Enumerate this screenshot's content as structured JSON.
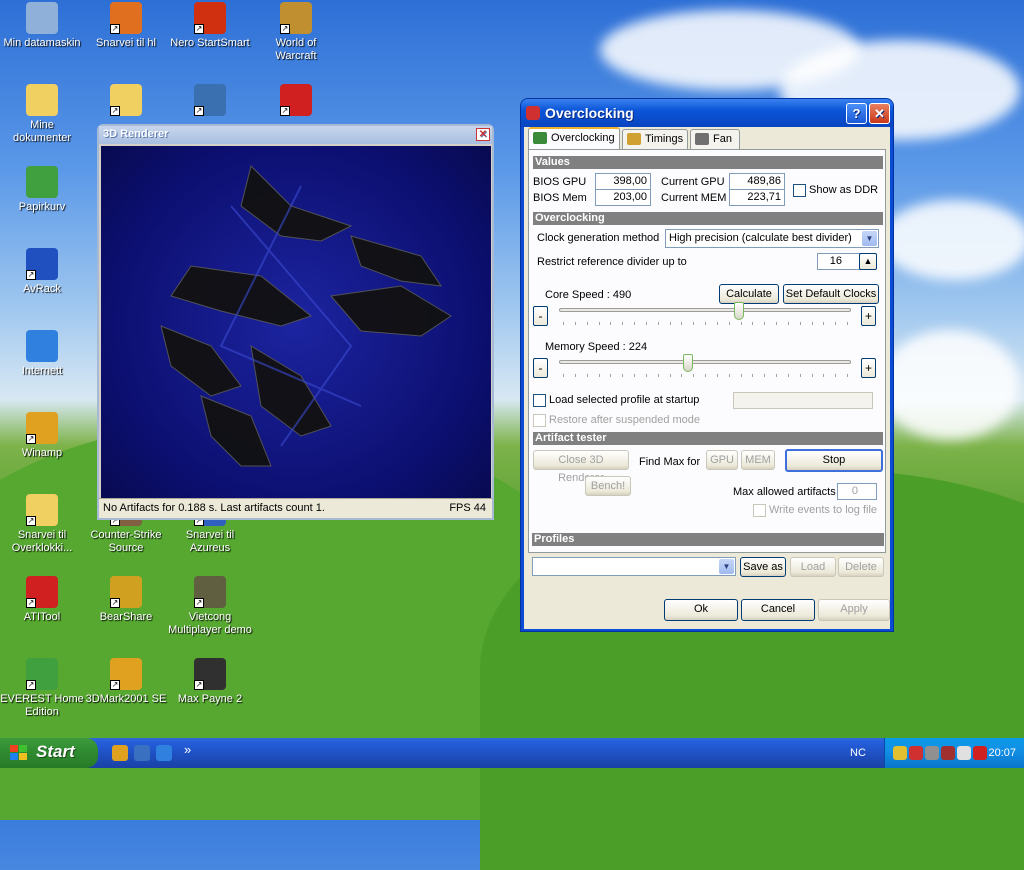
{
  "desktop": {
    "icons": [
      {
        "label": "Min datamaskin",
        "color": "#8fb0d8"
      },
      {
        "label": "Snarvei til hl",
        "color": "#e07020"
      },
      {
        "label": "Nero StartSmart",
        "color": "#d03010"
      },
      {
        "label": "World of Warcraft",
        "color": "#c09030"
      },
      {
        "label": "Mine dokumenter",
        "color": "#f0d060"
      },
      {
        "label": "",
        "color": "#f0d060"
      },
      {
        "label": "",
        "color": "#3a6fb0"
      },
      {
        "label": "",
        "color": "#d02020"
      },
      {
        "label": "Papirkurv",
        "color": "#40a040"
      },
      {
        "label": "AvRack",
        "color": "#2050c0"
      },
      {
        "label": "Internett",
        "color": "#3080e0"
      },
      {
        "label": "Winamp",
        "color": "#e0a020"
      },
      {
        "label": "Snarvei til Overklokki...",
        "color": "#f0d060"
      },
      {
        "label": "Counter-Strike Source",
        "color": "#806040"
      },
      {
        "label": "Snarvei til Azureus",
        "color": "#3060c0"
      },
      {
        "label": "ATITool",
        "color": "#d02020"
      },
      {
        "label": "BearShare",
        "color": "#d0a020"
      },
      {
        "label": "Vietcong Multiplayer demo",
        "color": "#606040"
      },
      {
        "label": "EVEREST Home Edition",
        "color": "#40a040"
      },
      {
        "label": "3DMark2001 SE",
        "color": "#e0a020"
      },
      {
        "label": "Max Payne 2",
        "color": "#303030"
      }
    ]
  },
  "renderer": {
    "title": "3D Renderer",
    "status_left": "No Artifacts for 0.188 s. Last artifacts count 1.",
    "status_right": "FPS 44"
  },
  "dialog": {
    "title": "Overclocking",
    "help_label": "?",
    "close_label": "✕",
    "tabs": [
      {
        "label": "Overclocking"
      },
      {
        "label": "Timings"
      },
      {
        "label": "Fan"
      }
    ],
    "values": {
      "section": "Values",
      "bios_gpu_label": "BIOS GPU",
      "bios_gpu": "398,00",
      "bios_mem_label": "BIOS Mem",
      "bios_mem": "203,00",
      "current_gpu_label": "Current GPU",
      "current_gpu": "489,86",
      "current_mem_label": "Current MEM",
      "current_mem": "223,71",
      "show_ddr": "Show as DDR"
    },
    "overclocking": {
      "section": "Overclocking",
      "clock_method_label": "Clock generation method",
      "clock_method": "High precision (calculate best divider)",
      "restrict_label": "Restrict reference divider up to",
      "restrict_value": "16",
      "core_label": "Core Speed : 490",
      "core_fraction": 0.62,
      "calculate": "Calculate",
      "set_default": "Set Default Clocks",
      "memory_label": "Memory Speed : 224",
      "memory_fraction": 0.44,
      "minus": "-",
      "plus": "+",
      "load_profile": "Load selected profile at startup",
      "restore": "Restore after suspended mode"
    },
    "artifact": {
      "section": "Artifact tester",
      "close_renderer": "Close 3D Renderer",
      "find_max": "Find Max for",
      "gpu": "GPU",
      "mem": "MEM",
      "stop": "Stop",
      "bench": "Bench!",
      "max_allowed_label": "Max allowed artifacts",
      "max_allowed": "0",
      "write_log": "Write events to log file"
    },
    "profiles": {
      "section": "Profiles",
      "selected": "",
      "save_as": "Save as",
      "load": "Load",
      "delete": "Delete"
    },
    "ok": "Ok",
    "cancel": "Cancel",
    "apply": "Apply"
  },
  "taskbar": {
    "start": "Start",
    "chevron": "»",
    "lang": "NC",
    "clock": "20:07"
  }
}
